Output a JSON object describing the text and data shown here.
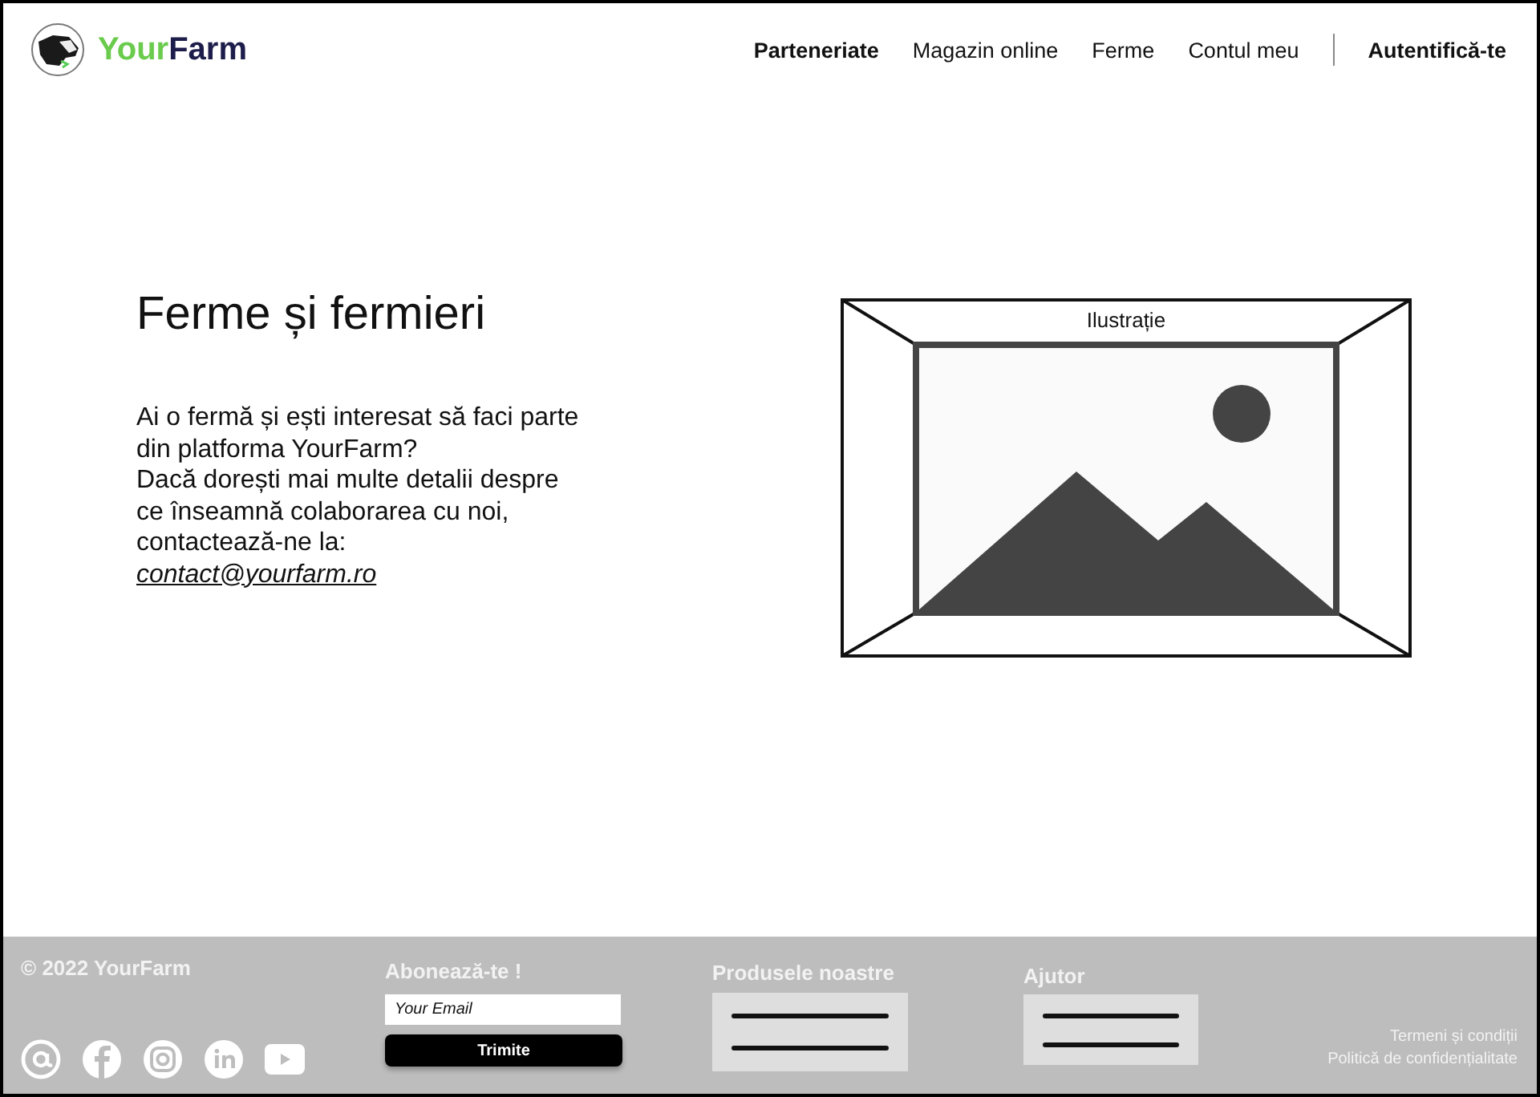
{
  "header": {
    "logo": {
      "part_a": "Your",
      "part_b": "Farm"
    },
    "nav": [
      {
        "label": "Parteneriate",
        "selected": true
      },
      {
        "label": "Magazin online",
        "selected": false
      },
      {
        "label": "Ferme",
        "selected": false
      },
      {
        "label": "Contul meu",
        "selected": false
      }
    ],
    "login": "Autentifică-te"
  },
  "hero": {
    "title": "Ferme și fermieri",
    "text": "Ai o fermă și ești interesat să faci parte\ndin platforma YourFarm?\nDacă dorești mai multe detalii despre\nce înseamnă colaborarea cu noi,\ncontactează-ne la:",
    "email": "contact@yourfarm.ro",
    "illustration": {
      "caption": "Ilustrație"
    }
  },
  "footer": {
    "copyright": "© 2022 YourFarm",
    "social": [
      {
        "kind": "email"
      },
      {
        "kind": "facebook"
      },
      {
        "kind": "instagram"
      },
      {
        "kind": "linkedin"
      },
      {
        "kind": "youtube"
      }
    ],
    "subscribe": {
      "title": "Abonează-te !",
      "placeholder": "Your Email",
      "button": "Trimite"
    },
    "products": {
      "title": "Produsele noastre"
    },
    "help": {
      "title": "Ajutor"
    },
    "links": [
      "Termeni și condiții",
      "Politică de confidențialitate"
    ]
  }
}
